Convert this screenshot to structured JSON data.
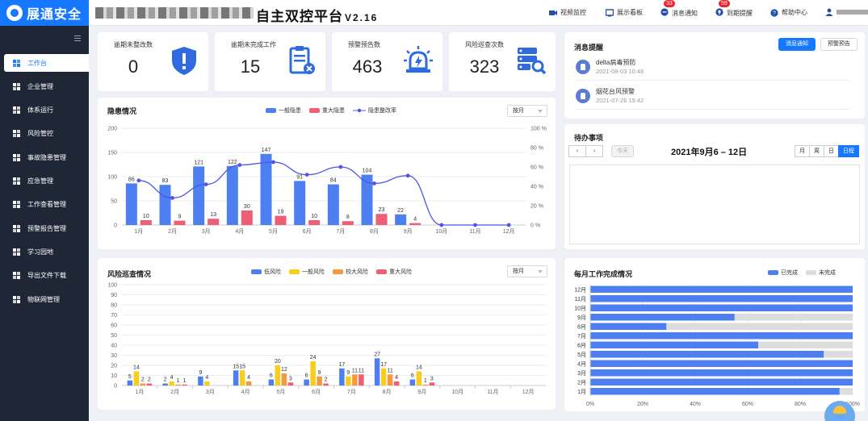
{
  "brand": {
    "name": "展通安全",
    "title": "自主双控平台",
    "version": "V2.16"
  },
  "topnav": [
    {
      "label": "视频监控",
      "icon": "video-icon",
      "badge": null
    },
    {
      "label": "展示看板",
      "icon": "board-icon",
      "badge": null
    },
    {
      "label": "消息通知",
      "icon": "message-icon",
      "badge": "33"
    },
    {
      "label": "到期提醒",
      "icon": "bell-icon",
      "badge": "59"
    },
    {
      "label": "帮助中心",
      "icon": "help-icon",
      "badge": null
    }
  ],
  "sidebar": [
    {
      "label": "工作台",
      "icon": "workbench-icon",
      "active": true
    },
    {
      "label": "企业管理",
      "icon": "home-icon",
      "active": false
    },
    {
      "label": "体系运行",
      "icon": "system-icon",
      "active": false
    },
    {
      "label": "风险管控",
      "icon": "risk-icon",
      "active": false
    },
    {
      "label": "事故隐患管理",
      "icon": "hazard-icon",
      "active": false
    },
    {
      "label": "应急管理",
      "icon": "emergency-icon",
      "active": false
    },
    {
      "label": "工作查看管理",
      "icon": "calendar-icon",
      "active": false
    },
    {
      "label": "预警报告管理",
      "icon": "report-icon",
      "active": false
    },
    {
      "label": "学习园地",
      "icon": "study-icon",
      "active": false
    },
    {
      "label": "导出文件下载",
      "icon": "download-icon",
      "active": false
    },
    {
      "label": "物联网管理",
      "icon": "iot-icon",
      "active": false
    }
  ],
  "stats": [
    {
      "label": "逾期未整改数",
      "value": "0",
      "icon": "shield-icon"
    },
    {
      "label": "逾期未完成工作",
      "value": "15",
      "icon": "clipboard-icon"
    },
    {
      "label": "预警预告数",
      "value": "463",
      "icon": "alarm-icon"
    },
    {
      "label": "风险巡查次数",
      "value": "323",
      "icon": "database-search-icon"
    }
  ],
  "hazard_panel": {
    "title": "隐患情况",
    "select": "按月"
  },
  "risk_panel": {
    "title": "风险巡查情况",
    "select": "按月"
  },
  "messages": {
    "title": "消息提醒",
    "btn_notice": "消息通知",
    "btn_warn": "预警预告",
    "items": [
      {
        "title": "delta病毒预防",
        "date": "2021-08-03 10:48"
      },
      {
        "title": "烟花台风预警",
        "date": "2021-07-26 15:42"
      }
    ]
  },
  "todo": {
    "title": "待办事项",
    "today": "今天",
    "range": "2021年9月6 – 12日",
    "views": [
      "月",
      "周",
      "日",
      "日程"
    ],
    "active_view": "日程"
  },
  "monthly": {
    "title": "每月工作完成情况"
  },
  "chart_data": [
    {
      "type": "bar",
      "title": "隐患情况",
      "categories": [
        "1月",
        "2月",
        "3月",
        "4月",
        "5月",
        "6月",
        "7月",
        "8月",
        "9月",
        "10月",
        "11月",
        "12月"
      ],
      "series": [
        {
          "name": "一般隐患",
          "kind": "bar",
          "color": "#4e7ff0",
          "values": [
            86,
            83,
            121,
            122,
            147,
            91,
            84,
            104,
            22,
            0,
            0,
            0
          ]
        },
        {
          "name": "重大隐患",
          "kind": "bar",
          "color": "#ee5f74",
          "values": [
            10,
            9,
            13,
            30,
            19,
            10,
            8,
            23,
            4,
            0,
            0,
            0
          ]
        },
        {
          "name": "隐患整改率",
          "kind": "line",
          "color": "#4f55e8",
          "values": [
            46,
            28,
            42,
            62,
            65,
            52,
            60,
            43,
            51,
            0,
            0,
            0
          ]
        }
      ],
      "ylim": [
        0,
        200
      ],
      "yticks": [
        0,
        50,
        100,
        150,
        200
      ],
      "y2lim": [
        0,
        100
      ],
      "y2ticks": [
        "0 %",
        "20 %",
        "40 %",
        "60 %",
        "80 %",
        "100 %"
      ],
      "legend": "top-center",
      "grid": true
    },
    {
      "type": "bar",
      "title": "风险巡查情况",
      "categories": [
        "1月",
        "2月",
        "3月",
        "4月",
        "5月",
        "6月",
        "7月",
        "8月",
        "9月",
        "10月",
        "11月",
        "12月"
      ],
      "series": [
        {
          "name": "低风险",
          "color": "#4e7ff0",
          "values": [
            5,
            2,
            9,
            15,
            6,
            6,
            17,
            27,
            6,
            0,
            0,
            0
          ]
        },
        {
          "name": "一般风险",
          "color": "#f8cd1b",
          "values": [
            14,
            4,
            4,
            15,
            20,
            24,
            9,
            17,
            14,
            0,
            0,
            0
          ]
        },
        {
          "name": "较大风险",
          "color": "#f59a3c",
          "values": [
            2,
            1,
            0,
            4,
            12,
            9,
            11,
            11,
            1,
            0,
            0,
            0
          ]
        },
        {
          "name": "重大风险",
          "color": "#ee5f74",
          "values": [
            2,
            1,
            0,
            0,
            3,
            2,
            11,
            4,
            3,
            0,
            0,
            0
          ]
        }
      ],
      "ylim": [
        0,
        100
      ],
      "yticks": [
        0,
        10,
        20,
        30,
        40,
        50,
        60,
        70,
        80,
        90,
        100
      ],
      "legend": "top-center",
      "grid": true
    },
    {
      "type": "bar",
      "title": "每月工作完成情况",
      "orientation": "horizontal",
      "categories": [
        "12月",
        "11月",
        "10月",
        "9月",
        "8月",
        "7月",
        "6月",
        "5月",
        "4月",
        "3月",
        "2月",
        "1月"
      ],
      "series": [
        {
          "name": "已完成",
          "color": "#4e7ff0",
          "values": [
            100,
            100,
            100,
            55,
            29,
            100,
            64,
            89,
            100,
            100,
            100,
            95
          ]
        },
        {
          "name": "未完成",
          "color": "#dddddd",
          "values": [
            0,
            0,
            0,
            45,
            71,
            0,
            36,
            11,
            0,
            0,
            0,
            5
          ]
        }
      ],
      "xticks": [
        "0%",
        "20%",
        "40%",
        "60%",
        "80%",
        "100%"
      ],
      "xlim": [
        0,
        100
      ],
      "legend": "top-right",
      "grid": true
    }
  ]
}
